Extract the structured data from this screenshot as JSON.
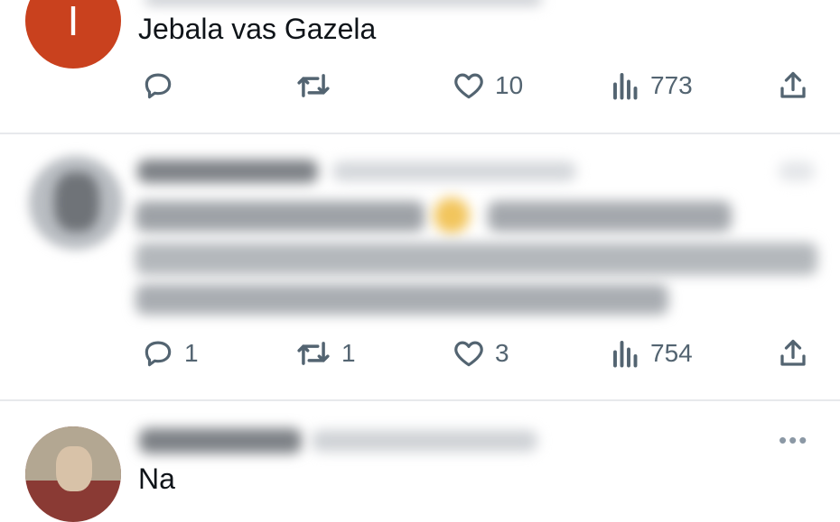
{
  "posts": [
    {
      "avatar_letter": "I",
      "avatar_color": "#c9411e",
      "text": "Jebala vas Gazela",
      "stats": {
        "replies": "",
        "reposts": "",
        "likes": "10",
        "views": "773"
      }
    },
    {
      "text": "",
      "stats": {
        "replies": "1",
        "reposts": "1",
        "likes": "3",
        "views": "754"
      }
    },
    {
      "text": "Na"
    }
  ],
  "icons": {
    "reply": "reply-icon",
    "repost": "repost-icon",
    "like": "heart-icon",
    "views": "views-icon",
    "share": "share-icon",
    "more": "more-icon"
  },
  "colors": {
    "background": "#ffffff",
    "divider": "#e7e9ec",
    "icon_gray": "#536471"
  }
}
